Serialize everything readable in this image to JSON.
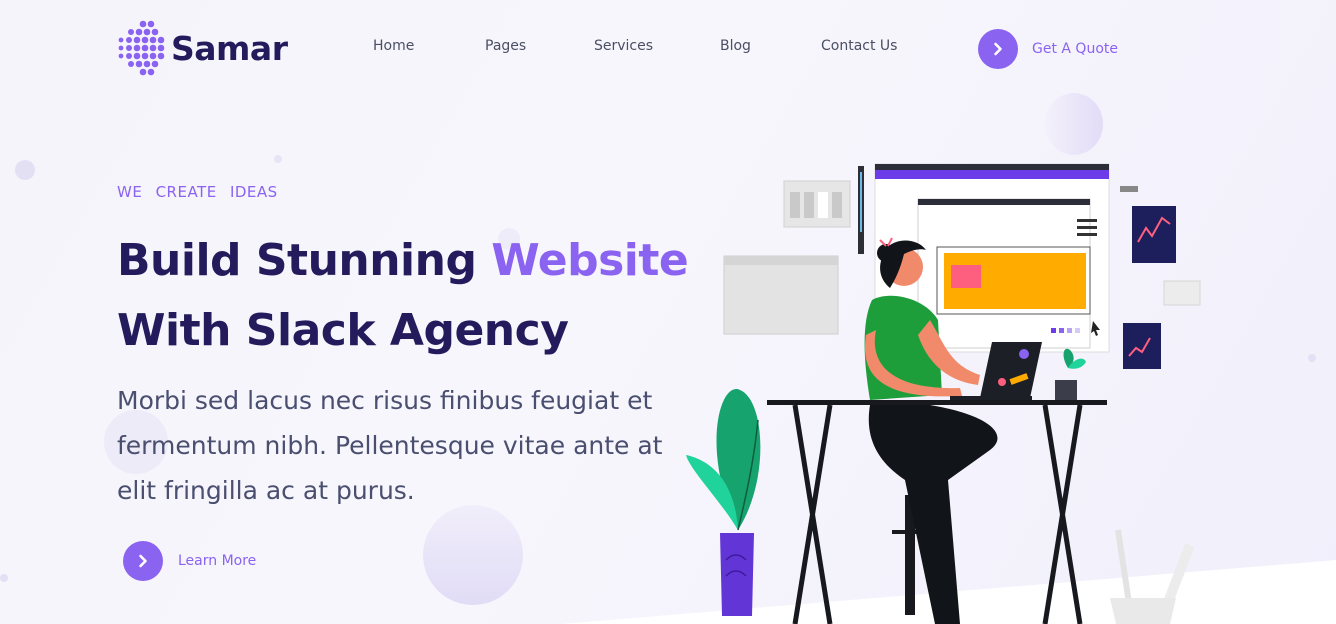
{
  "brand": {
    "name": "Samar"
  },
  "nav": {
    "items": [
      {
        "label": "Home"
      },
      {
        "label": "Pages"
      },
      {
        "label": "Services"
      },
      {
        "label": "Blog"
      },
      {
        "label": "Contact Us"
      }
    ],
    "cta": {
      "label": "Get A Quote",
      "icon": "chevron-right-icon"
    }
  },
  "hero": {
    "eyebrow": "WE CREATE IDEAS",
    "headline_part1": "Build Stunning ",
    "headline_accent": "Website",
    "headline_part2": "With Slack Agency",
    "lede": "Morbi sed lacus nec risus finibus feugiat et fermentum nibh. Pellentesque vitae ante at elit fringilla ac at purus.",
    "cta": {
      "label": "Learn More",
      "icon": "chevron-right-icon"
    }
  },
  "colors": {
    "accent": "#8a63f0",
    "heading": "#231b5c",
    "body_text": "#4a4f70"
  }
}
